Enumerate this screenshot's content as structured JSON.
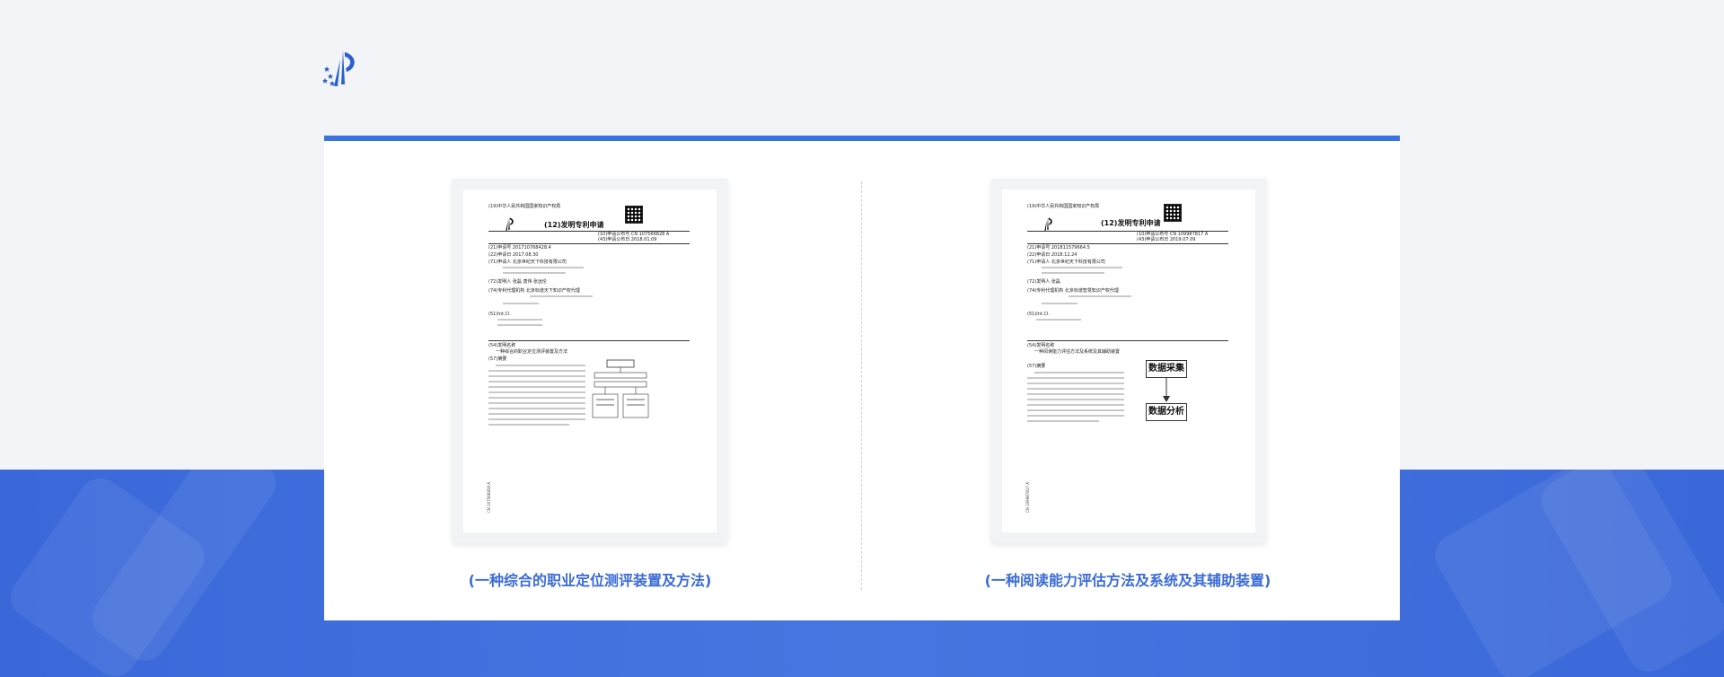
{
  "colors": {
    "accent": "#3a73e0",
    "caption": "#3a6bd6",
    "band": "#4471dd"
  },
  "patents": [
    {
      "caption": "(一种综合的职业定位测评装置及方法)",
      "doc": {
        "office": "(19)中华人民共和国国家知识产权局",
        "type": "(12)发明专利申请",
        "pub_no": "(10)申请公布号 CN 107566828 A",
        "pub_date": "(43)申请公布日 2018.01.09",
        "app_no": "(21)申请号 201710768428.4",
        "app_date": "(22)申请日 2017.08.30",
        "applicant": "(71)申请人 北京世纪天下科技有限公司",
        "inventor": "(72)发明人 张磊  唐伟  张远伦",
        "agency": "(74)专利代理机构 北京标谱天下知识产权代理",
        "ipc": "(51)Int.Cl.",
        "title_label": "(54)发明名称",
        "title": "一种综合的职业定位测评装置及方法",
        "abstract_label": "(57)摘要",
        "abstract": "本发明公开了一种综合的职业定位测评方法及装置，涉及数据处理技术领域",
        "side_no": "CN 107566828 A"
      }
    },
    {
      "caption": "(一种阅读能力评估方法及系统及其辅助装置)",
      "doc": {
        "office": "(19)中华人民共和国国家知识产权局",
        "type": "(12)发明专利申请",
        "pub_no": "(10)申请公布号 CN 109987817 A",
        "pub_date": "(43)申请公布日 2019.07.09",
        "app_no": "(21)申请号 201811579664.5",
        "app_date": "(22)申请日 2018.12.24",
        "applicant": "(71)申请人 北京世纪天下科技有限公司",
        "inventor": "(72)发明人 张磊",
        "agency": "(74)专利代理机构 北京标谱智慧知识产权代理",
        "ipc": "(51)Int.Cl.",
        "title_label": "(54)发明名称",
        "title": "一种阅读能力评估方法及系统及其辅助装置",
        "abstract_label": "(57)摘要",
        "abstract": "本发明公开了一种阅读能力评估方法，包括数据采集和数据分析",
        "box1": "数据采集",
        "box2": "数据分析",
        "side_no": "CN 109987817 A"
      }
    }
  ]
}
